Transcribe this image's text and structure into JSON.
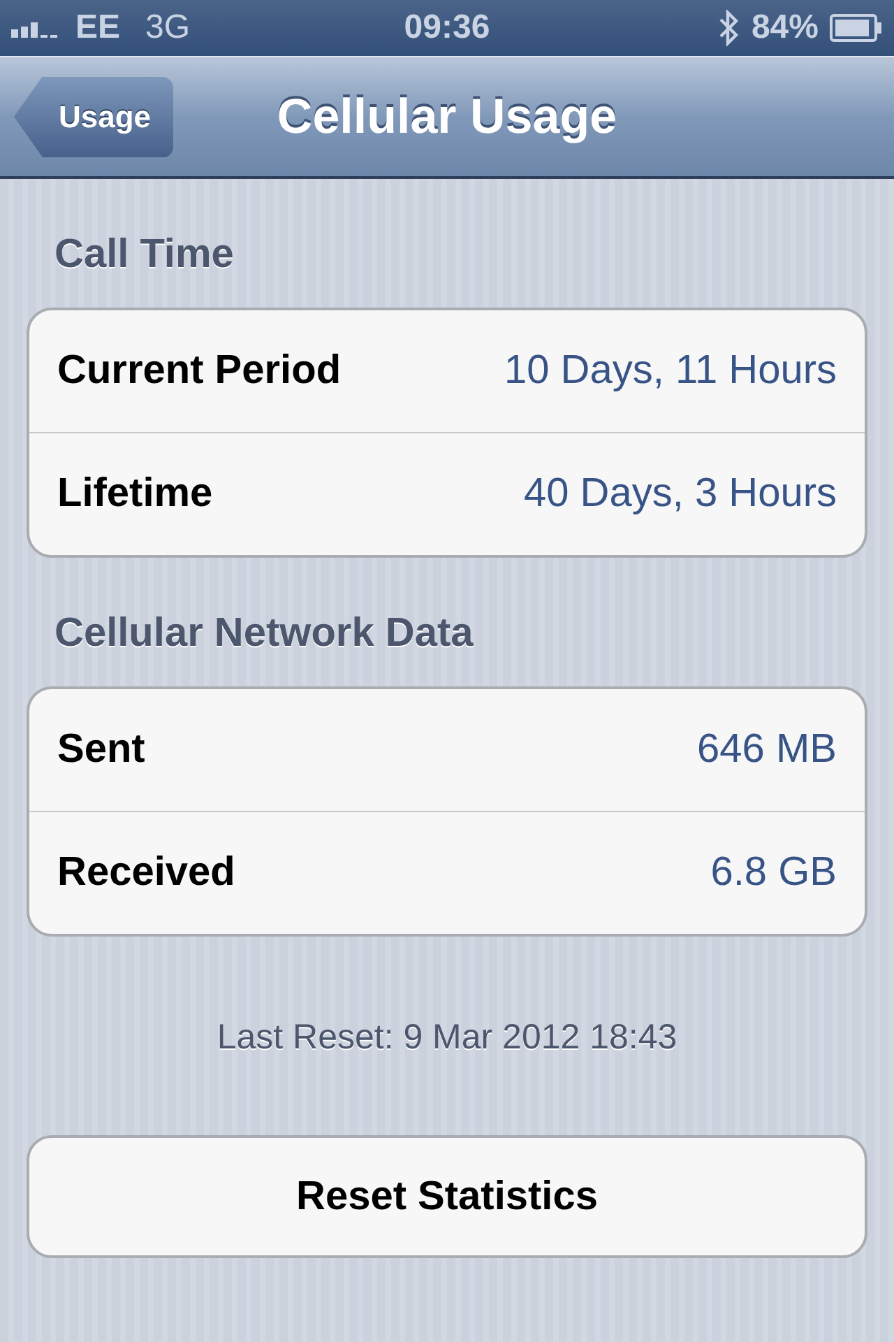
{
  "status_bar": {
    "carrier": "EE",
    "network": "3G",
    "time": "09:36",
    "battery": "84%"
  },
  "nav_bar": {
    "back": "Usage",
    "title": "Cellular Usage"
  },
  "groups": [
    {
      "header": "Call Time",
      "rows": [
        {
          "label": "Current Period",
          "value": "10 Days, 11 Hours"
        },
        {
          "label": "Lifetime",
          "value": "40 Days, 3 Hours"
        }
      ]
    },
    {
      "header": "Cellular Network Data",
      "rows": [
        {
          "label": "Sent",
          "value": "646 MB"
        },
        {
          "label": "Received",
          "value": "6.8 GB"
        }
      ]
    }
  ],
  "footer": "Last Reset: 9 Mar 2012 18:43",
  "button": "Reset Statistics"
}
